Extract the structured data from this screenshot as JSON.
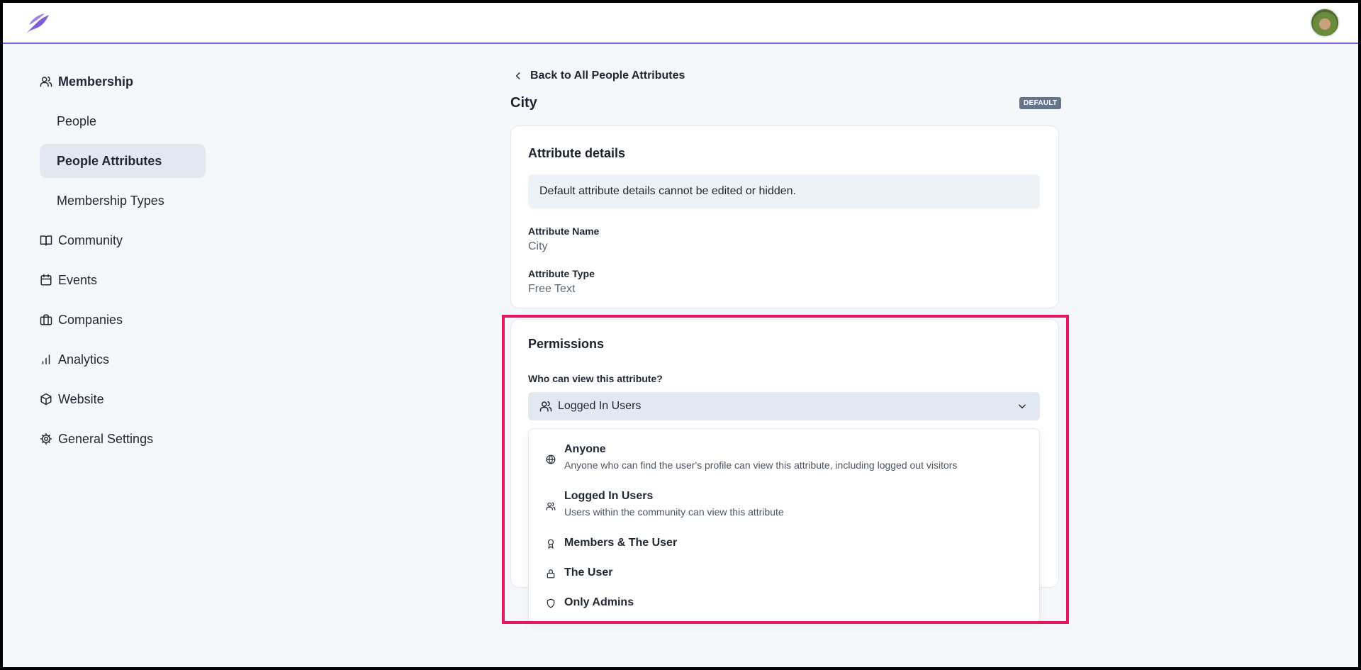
{
  "sidebar": {
    "membership": "Membership",
    "people": "People",
    "people_attributes": "People Attributes",
    "membership_types": "Membership Types",
    "community": "Community",
    "events": "Events",
    "companies": "Companies",
    "analytics": "Analytics",
    "website": "Website",
    "general_settings": "General Settings"
  },
  "header": {
    "back_label": "Back to All People Attributes",
    "title": "City",
    "badge": "DEFAULT"
  },
  "details": {
    "title": "Attribute details",
    "info": "Default attribute details cannot be edited or hidden.",
    "name_label": "Attribute Name",
    "name_value": "City",
    "type_label": "Attribute Type",
    "type_value": "Free Text"
  },
  "permissions": {
    "title": "Permissions",
    "question": "Who can view this attribute?",
    "selected": "Logged In Users",
    "options": [
      {
        "label": "Anyone",
        "desc": "Anyone who can find the user's profile can view this attribute, including logged out visitors",
        "icon": "globe-icon"
      },
      {
        "label": "Logged In Users",
        "desc": "Users within the community can view this attribute",
        "icon": "users-icon"
      },
      {
        "label": "Members & The User",
        "icon": "award-icon"
      },
      {
        "label": "The User",
        "icon": "lock-icon"
      },
      {
        "label": "Only Admins",
        "icon": "shield-icon"
      }
    ]
  },
  "colors": {
    "accent": "#7b5fd9",
    "highlight": "#e8175d",
    "badge": "#64748b"
  }
}
